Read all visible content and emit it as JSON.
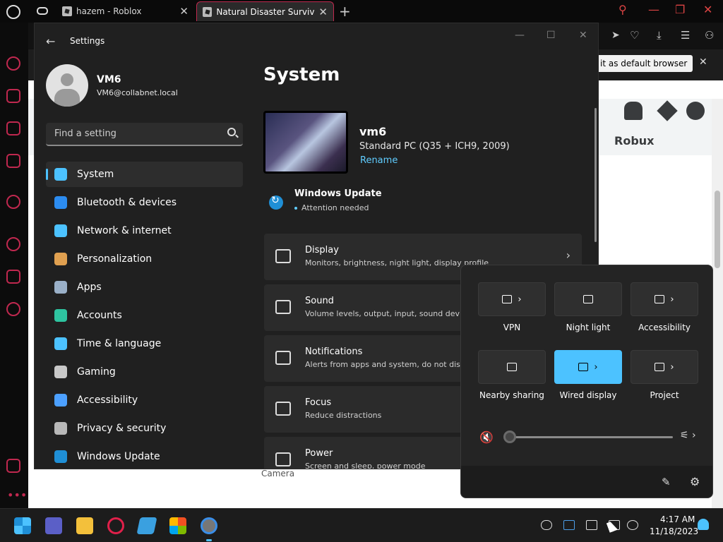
{
  "browser": {
    "tabs": [
      {
        "title": "hazem - Roblox"
      },
      {
        "title": "Natural Disaster Survival - R"
      }
    ],
    "default_banner_label": "it as default browser",
    "robux_label": "Robux",
    "camera_label": "Camera"
  },
  "settings": {
    "window_title": "Settings",
    "user": {
      "name": "VM6",
      "email": "VM6@collabnet.local"
    },
    "search_placeholder": "Find a setting",
    "nav": [
      {
        "label": "System",
        "icon": "monitor-icon",
        "color": "#4cc2ff"
      },
      {
        "label": "Bluetooth & devices",
        "icon": "bluetooth-icon",
        "color": "#2c8cf0"
      },
      {
        "label": "Network & internet",
        "icon": "wifi-icon",
        "color": "#4cc2ff"
      },
      {
        "label": "Personalization",
        "icon": "brush-icon",
        "color": "#e0a050"
      },
      {
        "label": "Apps",
        "icon": "apps-icon",
        "color": "#9ab0c8"
      },
      {
        "label": "Accounts",
        "icon": "person-icon",
        "color": "#2ec4a0"
      },
      {
        "label": "Time & language",
        "icon": "globe-clock-icon",
        "color": "#4cc2ff"
      },
      {
        "label": "Gaming",
        "icon": "gamepad-icon",
        "color": "#c8c8c8"
      },
      {
        "label": "Accessibility",
        "icon": "accessibility-icon",
        "color": "#4ca0ff"
      },
      {
        "label": "Privacy & security",
        "icon": "shield-icon",
        "color": "#b8b8b8"
      },
      {
        "label": "Windows Update",
        "icon": "update-icon",
        "color": "#1f8fd6"
      }
    ],
    "main": {
      "title": "System",
      "pc_name": "vm6",
      "pc_model": "Standard PC (Q35 + ICH9, 2009)",
      "rename_label": "Rename",
      "update_title": "Windows Update",
      "update_status": "Attention needed",
      "cards": [
        {
          "title": "Display",
          "desc": "Monitors, brightness, night light, display profile",
          "icon": "display-icon"
        },
        {
          "title": "Sound",
          "desc": "Volume levels, output, input, sound devices",
          "icon": "speaker-icon"
        },
        {
          "title": "Notifications",
          "desc": "Alerts from apps and system, do not disturb",
          "icon": "bell-icon"
        },
        {
          "title": "Focus",
          "desc": "Reduce distractions",
          "icon": "focus-icon"
        },
        {
          "title": "Power",
          "desc": "Screen and sleep, power mode",
          "icon": "power-icon"
        }
      ]
    }
  },
  "quick_settings": {
    "tiles": [
      {
        "label": "VPN",
        "icon": "vpn-shield-icon",
        "expand": true,
        "on": false
      },
      {
        "label": "Night light",
        "icon": "sun-icon",
        "expand": false,
        "on": false
      },
      {
        "label": "Accessibility",
        "icon": "accessibility-icon",
        "expand": true,
        "on": false
      },
      {
        "label": "Nearby sharing",
        "icon": "share-icon",
        "expand": false,
        "on": false
      },
      {
        "label": "Wired display",
        "icon": "cast-icon",
        "expand": true,
        "on": true
      },
      {
        "label": "Project",
        "icon": "project-icon",
        "expand": true,
        "on": false
      }
    ],
    "volume_level": 0,
    "accent": "#4cc2ff"
  },
  "taskbar": {
    "time": "4:17 AM",
    "date": "11/18/2023"
  }
}
